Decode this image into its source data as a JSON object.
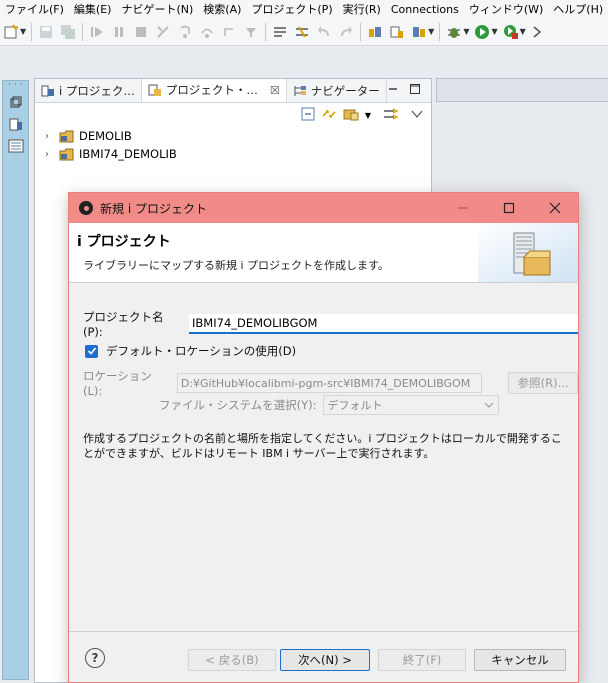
{
  "menu": [
    "ファイル(F)",
    "編集(E)",
    "ナビゲート(N)",
    "検索(A)",
    "プロジェクト(P)",
    "実行(R)",
    "Connections",
    "ウィンドウ(W)",
    "ヘルプ(H)"
  ],
  "icons": {
    "new": "new-wizard-icon",
    "save": "save-icon",
    "run": "run-icon",
    "debug": "debug-icon"
  },
  "view": {
    "tabs": [
      {
        "label": "i プロジェク…",
        "icon": "i-projects-icon"
      },
      {
        "label": "プロジェクト・…",
        "icon": "project-explorer-icon",
        "close": "☒"
      },
      {
        "label": "ナビゲーター",
        "icon": "navigator-icon"
      }
    ],
    "tree": [
      {
        "label": "DEMOLIB",
        "chevron": "›"
      },
      {
        "label": "IBMI74_DEMOLIB",
        "chevron": "›"
      }
    ]
  },
  "dialog": {
    "title": "新規 i プロジェクト",
    "header_title": "i プロジェクト",
    "header_desc": "ライブラリーにマップする新規 i プロジェクトを作成します。",
    "name_label": "プロジェクト名(P):",
    "name_value": "IBMI74_DEMOLIBGOM",
    "use_default_label": "デフォルト・ロケーションの使用(D)",
    "use_default_checked": true,
    "location_label": "ロケーション(L):",
    "location_value": "D:¥GitHub¥localibmi-pgm-src¥IBMI74_DEMOLIBGOM",
    "browse_label": "参照(R)...",
    "fs_label": "ファイル・システムを選択(Y):",
    "fs_value": "デフォルト",
    "description": "作成するプロジェクトの名前と場所を指定してください。i プロジェクトはローカルで開発することができますが、ビルドはリモート IBM i サーバー上で実行されます。",
    "help": "?",
    "back_label": "< 戻る(B)",
    "next_label": "次へ(N) >",
    "finish_label": "終了(F)",
    "cancel_label": "キャンセル"
  }
}
